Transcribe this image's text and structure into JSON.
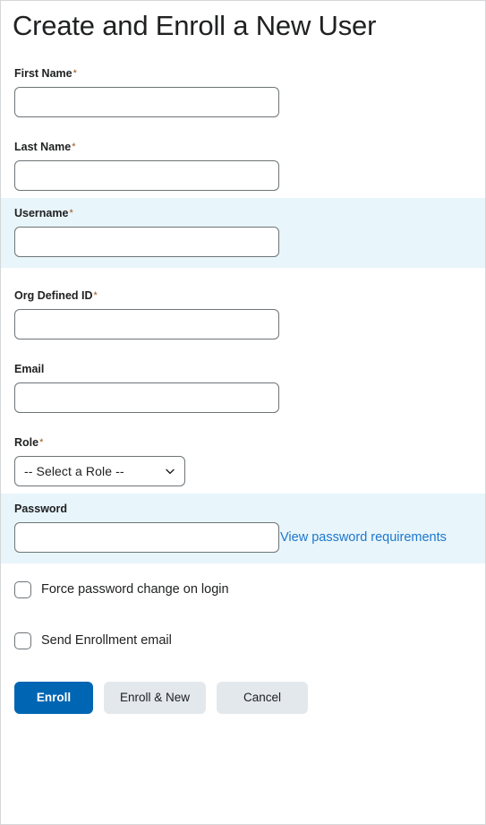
{
  "page": {
    "title": "Create and Enroll a New User",
    "required_marker": "*"
  },
  "colors": {
    "primary_button": "#0066b3",
    "secondary_button": "#e3e8ed",
    "link": "#1d77cc",
    "highlight_background": "#e8f5fb",
    "input_border": "#6e7477",
    "text": "#202122",
    "required_star": "#9b5414"
  },
  "fields": {
    "first_name": {
      "label": "First Name",
      "required": true,
      "value": "",
      "placeholder": ""
    },
    "last_name": {
      "label": "Last Name",
      "required": true,
      "value": "",
      "placeholder": ""
    },
    "username": {
      "label": "Username",
      "required": true,
      "value": "",
      "placeholder": "",
      "highlighted": true
    },
    "org_defined_id": {
      "label": "Org Defined ID",
      "required": true,
      "value": "",
      "placeholder": ""
    },
    "email": {
      "label": "Email",
      "required": false,
      "value": "",
      "placeholder": ""
    },
    "role": {
      "label": "Role",
      "required": true,
      "selected": "-- Select a Role --",
      "icon": "chevron-down-icon"
    },
    "password": {
      "label": "Password",
      "required": false,
      "value": "",
      "placeholder": "",
      "highlighted": true,
      "requirements_link": "View password requirements"
    }
  },
  "checkboxes": [
    {
      "label": "Force password change on login",
      "checked": false
    },
    {
      "label": "Send Enrollment email",
      "checked": false
    }
  ],
  "buttons": {
    "enroll": "Enroll",
    "enroll_and_new": "Enroll & New",
    "cancel": "Cancel"
  }
}
